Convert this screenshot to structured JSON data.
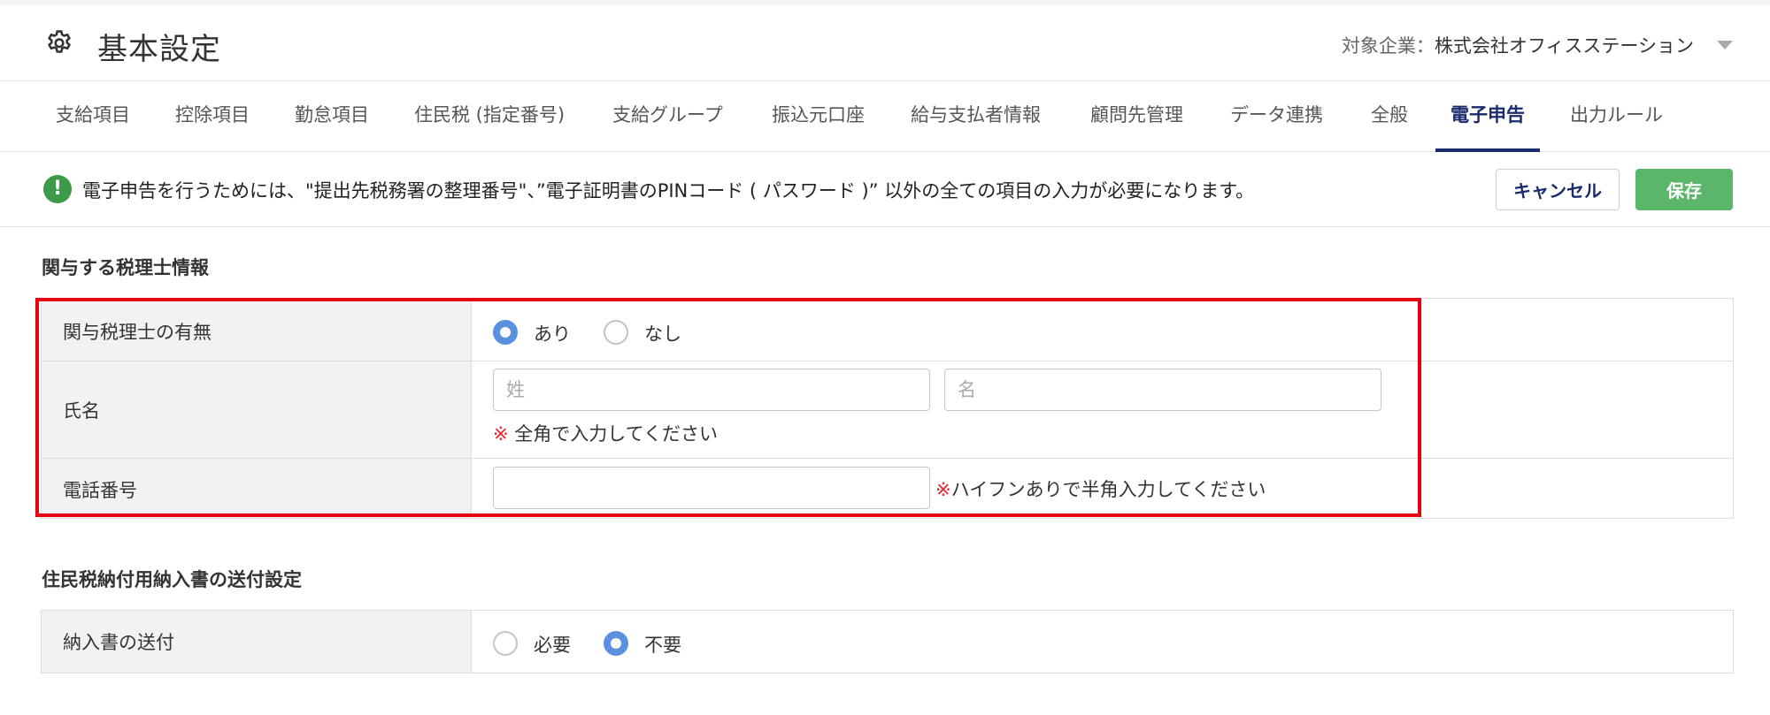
{
  "header": {
    "title": "基本設定",
    "gear_icon": "gear-icon",
    "company_label": "対象企業：",
    "company_name": "株式会社オフィスステーション"
  },
  "tabs": [
    {
      "label": "支給項目"
    },
    {
      "label": "控除項目"
    },
    {
      "label": "勤怠項目"
    },
    {
      "label": "住民税 (指定番号)"
    },
    {
      "label": "支給グループ"
    },
    {
      "label": "振込元口座"
    },
    {
      "label": "給与支払者情報"
    },
    {
      "label": "顧問先管理"
    },
    {
      "label": "データ連携"
    },
    {
      "label": "全般"
    },
    {
      "label": "電子申告",
      "active": true
    },
    {
      "label": "出力ルール"
    }
  ],
  "notice": {
    "icon": "exclamation-icon",
    "text": "電子申告を行うためには、\"提出先税務署の整理番号\"、”電子証明書のPINコード ( パスワード )” 以外の全ての項目の入力が必要になります。",
    "cancel_label": "キャンセル",
    "save_label": "保存"
  },
  "section1": {
    "title": "関与する税理士情報",
    "rows": {
      "presence": {
        "label": "関与税理士の有無",
        "options": [
          "あり",
          "なし"
        ],
        "selected": "あり"
      },
      "name": {
        "label": "氏名",
        "last_placeholder": "姓",
        "first_placeholder": "名",
        "last_value": "",
        "first_value": "",
        "hint_mark": "※",
        "hint": " 全角で入力してください"
      },
      "phone": {
        "label": "電話番号",
        "value": "",
        "hint_mark": "※",
        "hint": "ハイフンありで半角入力してください"
      }
    }
  },
  "section2": {
    "title": "住民税納付用納入書の送付設定",
    "rows": {
      "send": {
        "label": "納入書の送付",
        "options": [
          "必要",
          "不要"
        ],
        "selected": "不要"
      }
    }
  },
  "colors": {
    "accent": "#1a2a6c",
    "save": "#5cb66a",
    "radio_checked": "#5b8fe0",
    "highlight": "#e60012",
    "notice_icon": "#3c9a48"
  }
}
